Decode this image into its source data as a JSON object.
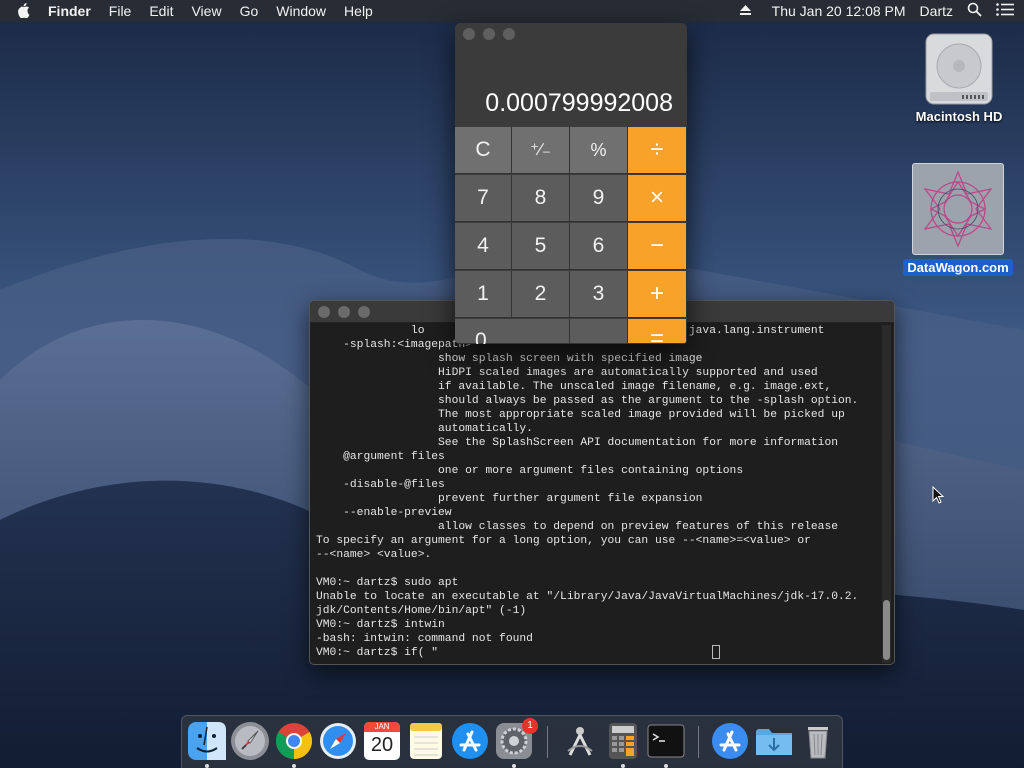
{
  "menubar": {
    "apple_icon": "apple-logo",
    "app_name": "Finder",
    "items": [
      "File",
      "Edit",
      "View",
      "Go",
      "Window",
      "Help"
    ],
    "datetime": "Thu Jan 20  12:08 PM",
    "user": "Dartz"
  },
  "desktop": {
    "icons": [
      {
        "label": "Macintosh HD",
        "icon": "hard-drive-icon"
      },
      {
        "label": "DataWagon.com",
        "icon": "geometric-star-icon",
        "selected": true
      }
    ]
  },
  "calculator": {
    "display": "0.000799992008",
    "keys": {
      "clear": "C",
      "sign": "⁺∕₋",
      "percent": "%",
      "divide": "÷",
      "seven": "7",
      "eight": "8",
      "nine": "9",
      "multiply": "×",
      "four": "4",
      "five": "5",
      "six": "6",
      "minus": "−",
      "one": "1",
      "two": "2",
      "three": "3",
      "plus": "+",
      "zero": "0",
      "decimal": ".",
      "equals": "="
    },
    "colors": {
      "operator": "#f8a22a"
    }
  },
  "terminal": {
    "lines": [
      "              lo                                t, see java.lang.instrument",
      "    -splash:<imagepath>",
      "                  show splash screen with specified image",
      "                  HiDPI scaled images are automatically supported and used",
      "                  if available. The unscaled image filename, e.g. image.ext,",
      "                  should always be passed as the argument to the -splash option.",
      "                  The most appropriate scaled image provided will be picked up",
      "                  automatically.",
      "                  See the SplashScreen API documentation for more information",
      "    @argument files",
      "                  one or more argument files containing options",
      "    -disable-@files",
      "                  prevent further argument file expansion",
      "    --enable-preview",
      "                  allow classes to depend on preview features of this release",
      "To specify an argument for a long option, you can use --<name>=<value> or",
      "--<name> <value>.",
      "",
      "VM0:~ dartz$ sudo apt",
      "Unable to locate an executable at \"/Library/Java/JavaVirtualMachines/jdk-17.0.2.",
      "jdk/Contents/Home/bin/apt\" (-1)",
      "VM0:~ dartz$ intwin",
      "-bash: intwin: command not found",
      "VM0:~ dartz$ if( \""
    ]
  },
  "dock": {
    "apps": [
      {
        "name": "Finder",
        "icon": "finder-icon",
        "running": true
      },
      {
        "name": "Launchpad",
        "icon": "rocket-icon",
        "running": false
      },
      {
        "name": "Chrome",
        "icon": "chrome-icon",
        "running": true
      },
      {
        "name": "Safari",
        "icon": "compass-icon",
        "running": false
      },
      {
        "name": "Calendar",
        "icon": "calendar-icon",
        "running": false,
        "month": "JAN",
        "day": "20"
      },
      {
        "name": "Notes",
        "icon": "notes-icon",
        "running": false
      },
      {
        "name": "App Store",
        "icon": "app-store-icon",
        "running": false
      },
      {
        "name": "System Preferences",
        "icon": "gear-icon",
        "running": true,
        "badge": "1"
      },
      {
        "name": "Xcode Instruments",
        "icon": "instruments-icon",
        "running": false
      },
      {
        "name": "Calculator",
        "icon": "calculator-icon",
        "running": true
      },
      {
        "name": "Terminal",
        "icon": "terminal-icon",
        "running": true
      },
      {
        "name": "Applications",
        "icon": "app-store-folder-icon",
        "running": false
      },
      {
        "name": "Downloads",
        "icon": "downloads-folder-icon",
        "running": false
      },
      {
        "name": "Trash",
        "icon": "trash-icon",
        "running": false
      }
    ]
  }
}
